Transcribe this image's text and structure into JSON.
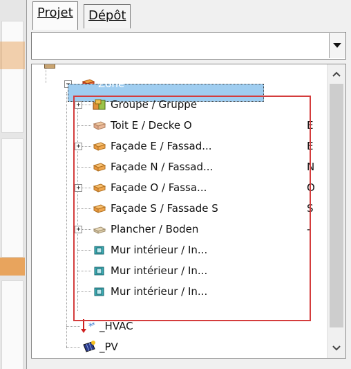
{
  "tabs": [
    {
      "label": "Projet",
      "active": true
    },
    {
      "label": "Dépôt",
      "active": false
    }
  ],
  "combo": {
    "value": ""
  },
  "tree": {
    "selected": {
      "label": "Zone"
    },
    "items": [
      {
        "label": "Groupe / Gruppe",
        "value": "",
        "icon": "group-icon"
      },
      {
        "label": "Toit E / Decke O",
        "value": "E",
        "icon": "roof-icon"
      },
      {
        "label": "Façade E / Fassad...",
        "value": "E",
        "icon": "wall-icon"
      },
      {
        "label": "Façade N / Fassad...",
        "value": "N",
        "icon": "wall-icon"
      },
      {
        "label": "Façade O / Fassa...",
        "value": "O",
        "icon": "wall-icon"
      },
      {
        "label": "Façade S / Fassade S",
        "value": "S",
        "icon": "wall-icon"
      },
      {
        "label": "Plancher / Boden",
        "value": "-",
        "icon": "floor-icon"
      },
      {
        "label": "Mur intérieur / In...",
        "value": "",
        "icon": "interior-wall-icon"
      },
      {
        "label": "Mur intérieur / In...",
        "value": "",
        "icon": "interior-wall-icon"
      },
      {
        "label": "Mur intérieur / In...",
        "value": "",
        "icon": "interior-wall-icon"
      }
    ],
    "tail": [
      {
        "label": "_HVAC",
        "icon": "hvac-icon"
      },
      {
        "label": "_PV",
        "icon": "pv-icon"
      }
    ]
  },
  "colors": {
    "selection": "#9fcdf0",
    "highlight": "#d43c3c"
  }
}
